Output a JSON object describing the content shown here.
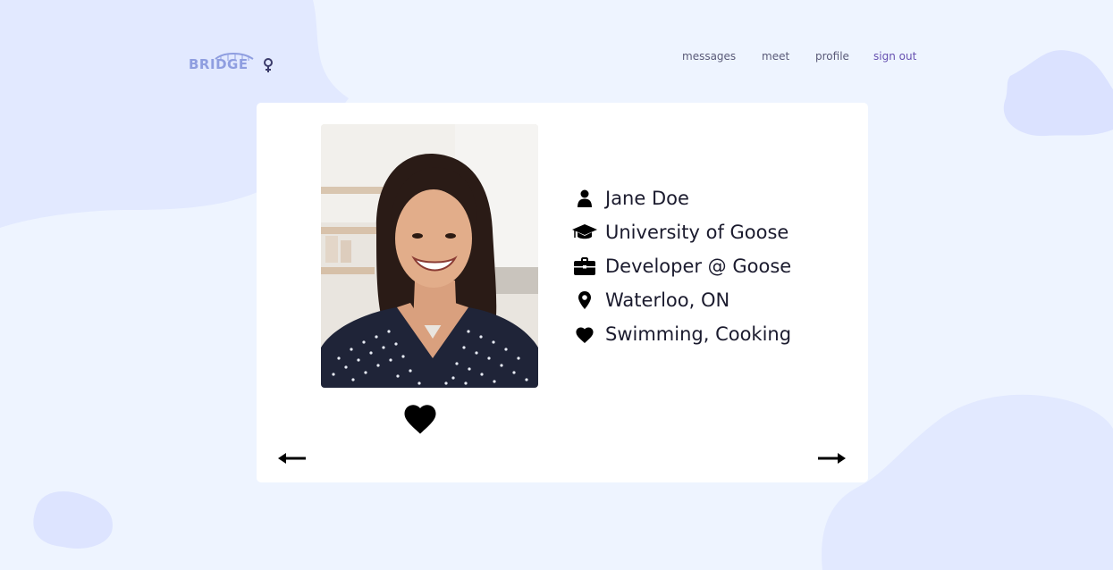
{
  "logo": {
    "text": "BRIDGE"
  },
  "nav": {
    "messages": "messages",
    "meet": "meet",
    "profile": "profile",
    "sign_out": "sign out"
  },
  "profile": {
    "name": "Jane Doe",
    "school": "University of Goose",
    "job": "Developer @ Goose",
    "location": "Waterloo, ON",
    "interests": "Swimming, Cooking"
  },
  "icons": {
    "name": "user-icon",
    "school": "graduation-cap-icon",
    "job": "briefcase-icon",
    "location": "map-pin-icon",
    "interests": "heart-icon",
    "like": "heart-icon",
    "prev": "arrow-left-icon",
    "next": "arrow-right-icon"
  },
  "colors": {
    "background": "#eef4ff",
    "blob": "#dde6ff",
    "card": "#ffffff",
    "nav_text": "#5a5a78",
    "sign_out": "#6650b0",
    "logo": "#8f9ee0",
    "text": "#1b1b2e"
  }
}
